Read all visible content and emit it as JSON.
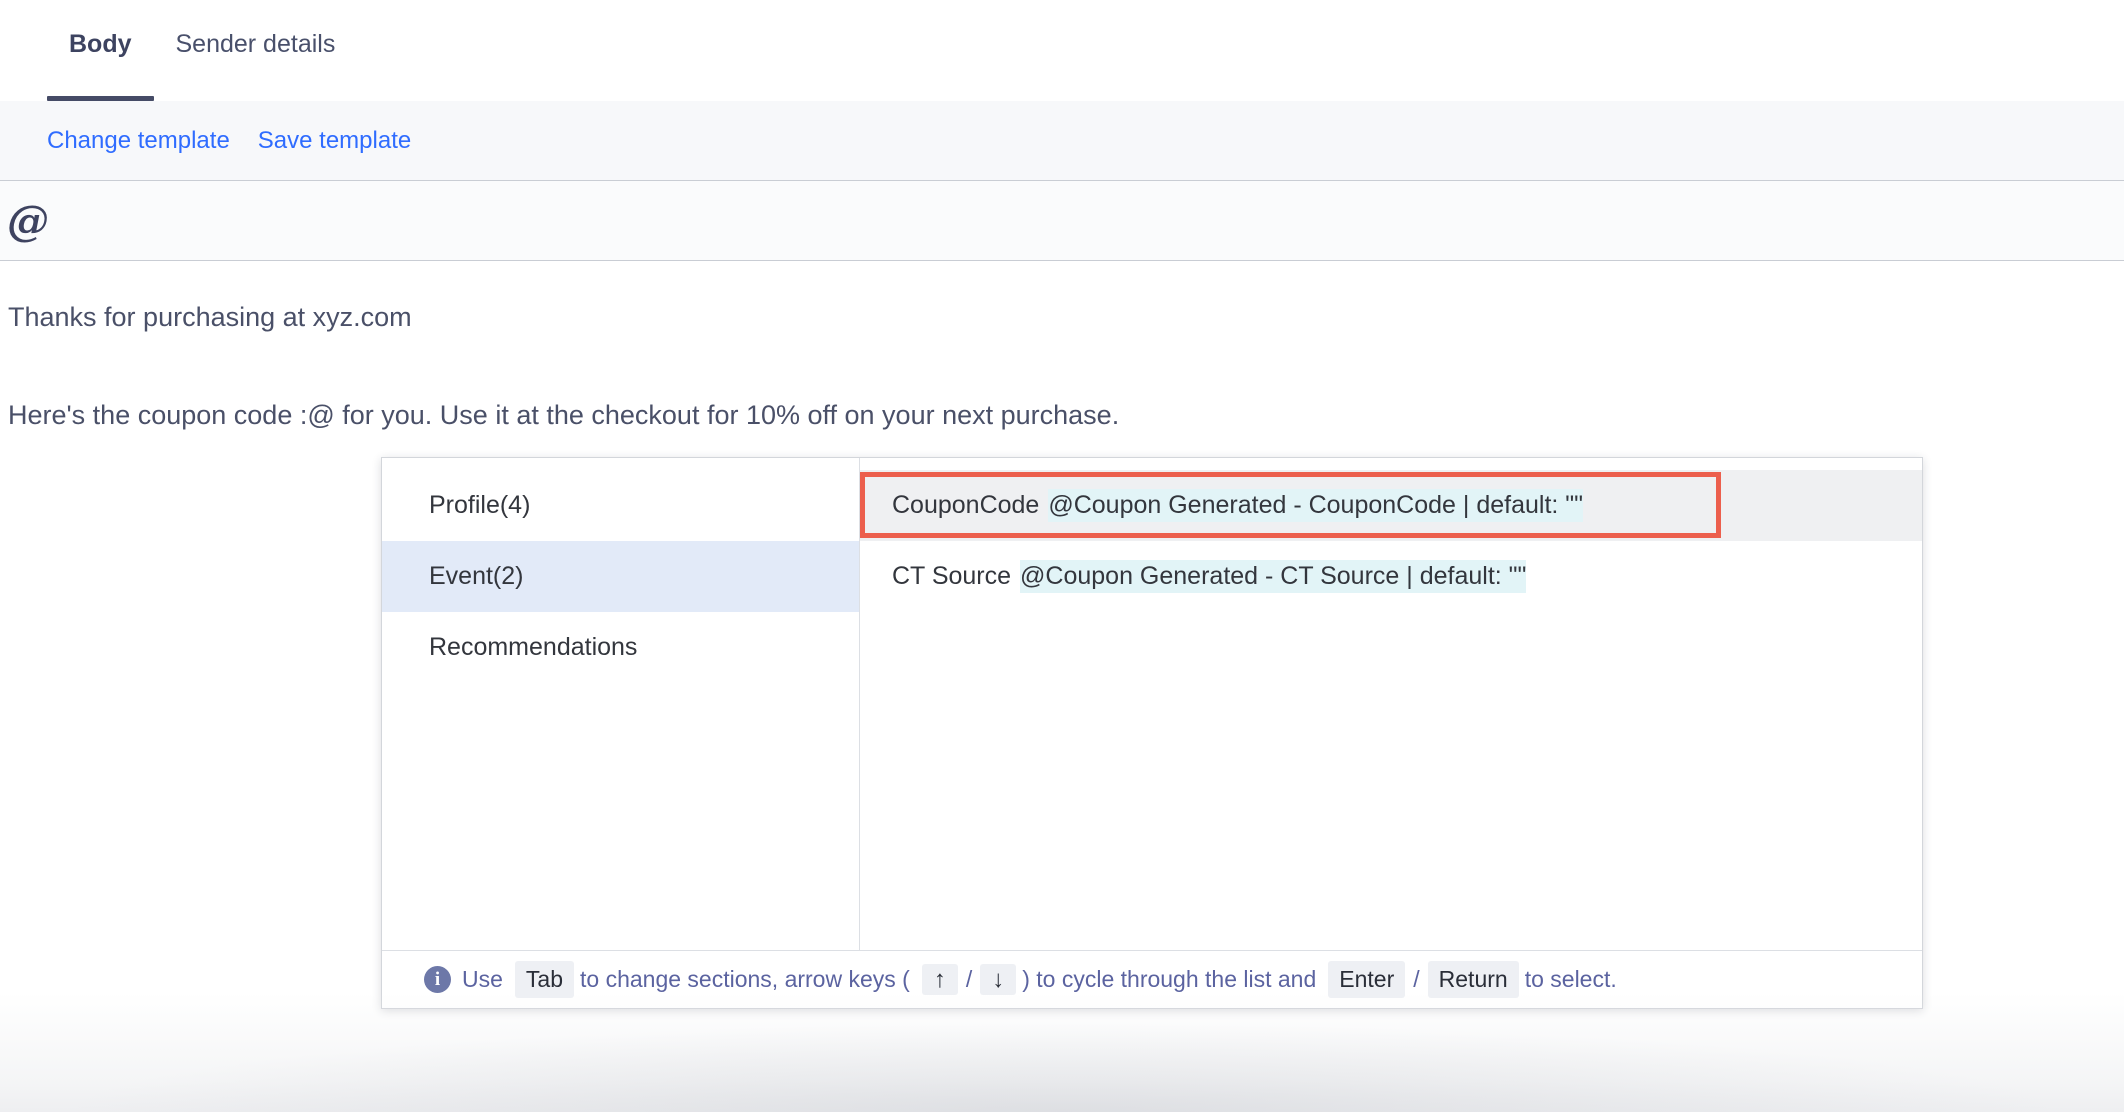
{
  "tabs": [
    {
      "label": "Body",
      "active": true
    },
    {
      "label": "Sender details",
      "active": false
    }
  ],
  "actionbar": {
    "change_template": "Change template",
    "save_template": "Save template"
  },
  "toolbar": {
    "at_icon": "at-sign-icon",
    "at_glyph": "@"
  },
  "email_body": {
    "line1": "Thanks for purchasing at xyz.com",
    "line2": "Here's the coupon code :@ for you. Use it at the checkout for 10% off on your next purchase."
  },
  "popup": {
    "categories": [
      {
        "label": "Profile(4)",
        "selected": false
      },
      {
        "label": "Event(2)",
        "selected": true
      },
      {
        "label": "Recommendations",
        "selected": false
      }
    ],
    "variables": [
      {
        "name": "CouponCode",
        "desc": "@Coupon Generated - CouponCode | default: \"\"",
        "active": true
      },
      {
        "name": "CT Source",
        "desc": "@Coupon Generated - CT Source | default: \"\"",
        "active": false
      }
    ],
    "footer": {
      "info_icon": "info-circle-icon",
      "info_glyph": "i",
      "use": "Use",
      "key_tab": "Tab",
      "mid1": "to change sections, arrow keys (",
      "key_up": "↑",
      "slash1": "/",
      "key_down": "↓",
      "mid2": ") to cycle through the list and",
      "key_enter": "Enter",
      "slash2": "/",
      "key_return": "Return",
      "tail": "to select."
    }
  },
  "colors": {
    "accent_link": "#2f6cff",
    "tab_underline": "#454b66",
    "focus_ring": "#ec5f4d",
    "selected_row": "#e2eaf8",
    "active_row": "#eff0f2",
    "desc_highlight": "#e2f4f7",
    "hint_text": "#5b63a0"
  }
}
